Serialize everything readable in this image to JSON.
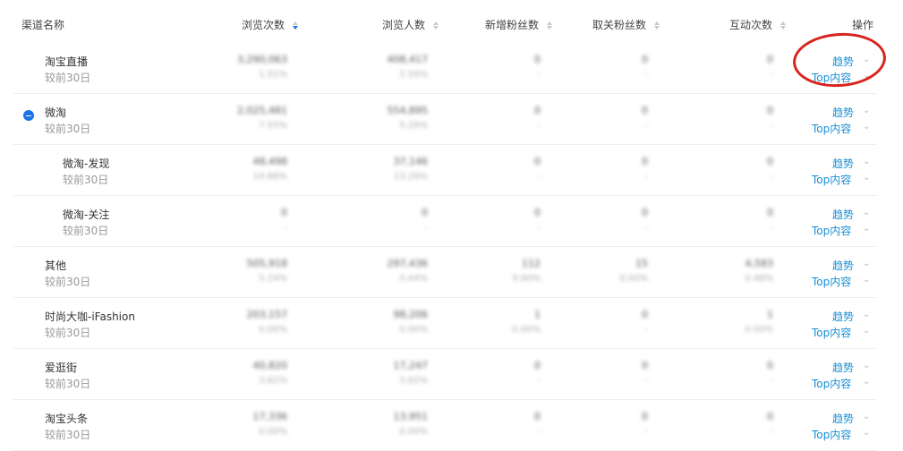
{
  "header": {
    "channel": "渠道名称",
    "views": "浏览次数",
    "visitors": "浏览人数",
    "new_fans": "新增粉丝数",
    "unfollow": "取关粉丝数",
    "interactions": "互动次数",
    "ops": "操作"
  },
  "actions": {
    "trend": "趋势",
    "top": "Top内容"
  },
  "compare_label": "较前30日",
  "rows": [
    {
      "name": "淘宝直播",
      "views": "3,290,063",
      "views_pct": "1.51%",
      "visitors": "408,417",
      "visitors_pct": "2.54%",
      "new_fans": "0",
      "new_fans_pct": "-",
      "unfollow": "0",
      "unfollow_pct": "-",
      "inter": "0",
      "inter_pct": "-"
    },
    {
      "name": "微淘",
      "views": "2,025,481",
      "views_pct": "7.55%",
      "visitors": "554,895",
      "visitors_pct": "5.29%",
      "new_fans": "0",
      "new_fans_pct": "-",
      "unfollow": "0",
      "unfollow_pct": "-",
      "inter": "0",
      "inter_pct": "-"
    },
    {
      "name": "微淘-发现",
      "views": "48,498",
      "views_pct": "14.88%",
      "visitors": "37,146",
      "visitors_pct": "13.29%",
      "new_fans": "0",
      "new_fans_pct": "-",
      "unfollow": "0",
      "unfollow_pct": "-",
      "inter": "0",
      "inter_pct": "-"
    },
    {
      "name": "微淘-关注",
      "views": "0",
      "views_pct": "-",
      "visitors": "0",
      "visitors_pct": "-",
      "new_fans": "0",
      "new_fans_pct": "-",
      "unfollow": "0",
      "unfollow_pct": "-",
      "inter": "0",
      "inter_pct": "-"
    },
    {
      "name": "其他",
      "views": "505,918",
      "views_pct": "5.24%",
      "visitors": "297,436",
      "visitors_pct": "0.44%",
      "new_fans": "112",
      "new_fans_pct": "9.80%",
      "unfollow": "15",
      "unfollow_pct": "0.00%",
      "inter": "4,583",
      "inter_pct": "0.48%"
    },
    {
      "name": "时尚大咖-iFashion",
      "views": "203,157",
      "views_pct": "0.00%",
      "visitors": "98,206",
      "visitors_pct": "0.00%",
      "new_fans": "1",
      "new_fans_pct": "0.00%",
      "unfollow": "0",
      "unfollow_pct": "-",
      "inter": "1",
      "inter_pct": "0.00%"
    },
    {
      "name": "爱逛街",
      "views": "40,820",
      "views_pct": "3.62%",
      "visitors": "17,247",
      "visitors_pct": "3.62%",
      "new_fans": "0",
      "new_fans_pct": "-",
      "unfollow": "0",
      "unfollow_pct": "-",
      "inter": "0",
      "inter_pct": "-"
    },
    {
      "name": "淘宝头条",
      "views": "17,336",
      "views_pct": "0.00%",
      "visitors": "13,951",
      "visitors_pct": "0.00%",
      "new_fans": "0",
      "new_fans_pct": "-",
      "unfollow": "0",
      "unfollow_pct": "-",
      "inter": "0",
      "inter_pct": "-"
    }
  ],
  "colors": {
    "link": "#1a8fd6",
    "accent": "#1a73e8",
    "annotation": "#d9231d"
  }
}
